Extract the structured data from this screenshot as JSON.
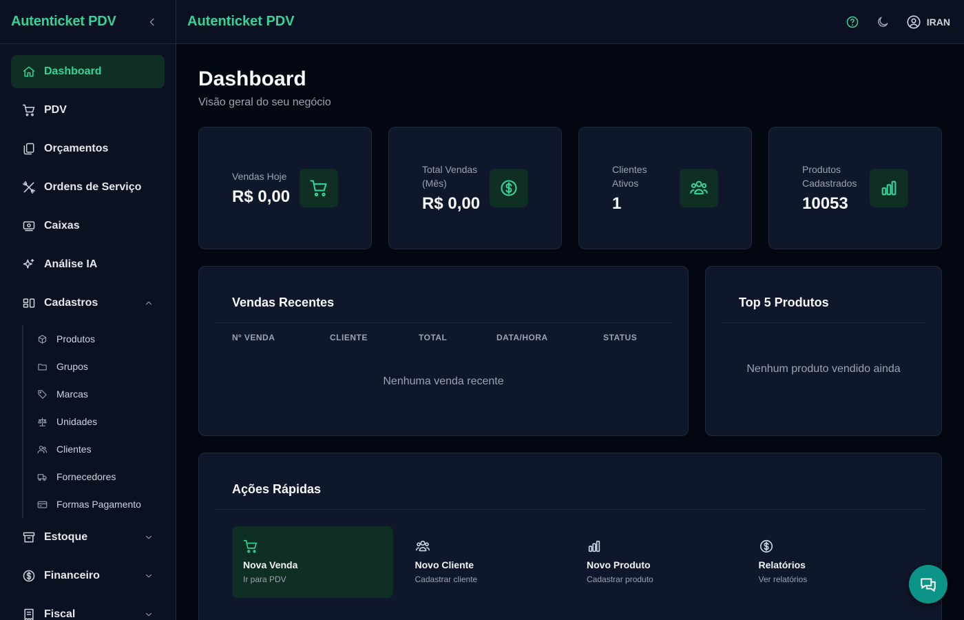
{
  "app": {
    "brand": "Autenticket PDV"
  },
  "header": {
    "title": "Autenticket PDV",
    "user": "IRAN"
  },
  "sidebar": {
    "items": [
      {
        "label": "Dashboard",
        "icon": "home-icon",
        "active": true
      },
      {
        "label": "PDV",
        "icon": "cart-icon"
      },
      {
        "label": "Orçamentos",
        "icon": "documents-icon"
      },
      {
        "label": "Ordens de Serviço",
        "icon": "tools-icon"
      },
      {
        "label": "Caixas",
        "icon": "cash-icon"
      },
      {
        "label": "Análise IA",
        "icon": "sparkles-icon"
      }
    ],
    "cadastros": {
      "label": "Cadastros",
      "items": [
        {
          "label": "Produtos",
          "icon": "package-icon"
        },
        {
          "label": "Grupos",
          "icon": "folder-icon"
        },
        {
          "label": "Marcas",
          "icon": "tag-icon"
        },
        {
          "label": "Unidades",
          "icon": "scale-icon"
        },
        {
          "label": "Clientes",
          "icon": "users-icon"
        },
        {
          "label": "Fornecedores",
          "icon": "truck-icon"
        },
        {
          "label": "Formas Pagamento",
          "icon": "credit-card-icon"
        }
      ]
    },
    "bottom": [
      {
        "label": "Estoque",
        "icon": "archive-icon"
      },
      {
        "label": "Financeiro",
        "icon": "dollar-icon"
      },
      {
        "label": "Fiscal",
        "icon": "receipt-icon"
      }
    ]
  },
  "page": {
    "title": "Dashboard",
    "subtitle": "Visão geral do seu negócio"
  },
  "stats": [
    {
      "label": "Vendas Hoje",
      "value": "R$ 0,00",
      "icon": "cart-icon"
    },
    {
      "label": "Total Vendas (Mês)",
      "value": "R$ 0,00",
      "icon": "dollar-icon"
    },
    {
      "label": "Clientes Ativos",
      "value": "1",
      "icon": "users-icon"
    },
    {
      "label": "Produtos Cadastrados",
      "value": "10053",
      "icon": "bar-chart-icon"
    }
  ],
  "recent_sales": {
    "title": "Vendas Recentes",
    "columns": [
      "Nº VENDA",
      "CLIENTE",
      "TOTAL",
      "DATA/HORA",
      "STATUS"
    ],
    "empty": "Nenhuma venda recente"
  },
  "top_products": {
    "title": "Top 5 Produtos",
    "empty": "Nenhum produto vendido ainda"
  },
  "quick_actions": {
    "title": "Ações Rápidas",
    "items": [
      {
        "title": "Nova Venda",
        "subtitle": "Ir para PDV",
        "icon": "cart-icon"
      },
      {
        "title": "Novo Cliente",
        "subtitle": "Cadastrar cliente",
        "icon": "users-icon"
      },
      {
        "title": "Novo Produto",
        "subtitle": "Cadastrar produto",
        "icon": "bar-chart-icon"
      },
      {
        "title": "Relatórios",
        "subtitle": "Ver relatórios",
        "icon": "dollar-icon"
      }
    ]
  },
  "colors": {
    "accent": "#34d399",
    "background": "#030712",
    "panel": "#0f172a",
    "fab": "#0d9488"
  }
}
